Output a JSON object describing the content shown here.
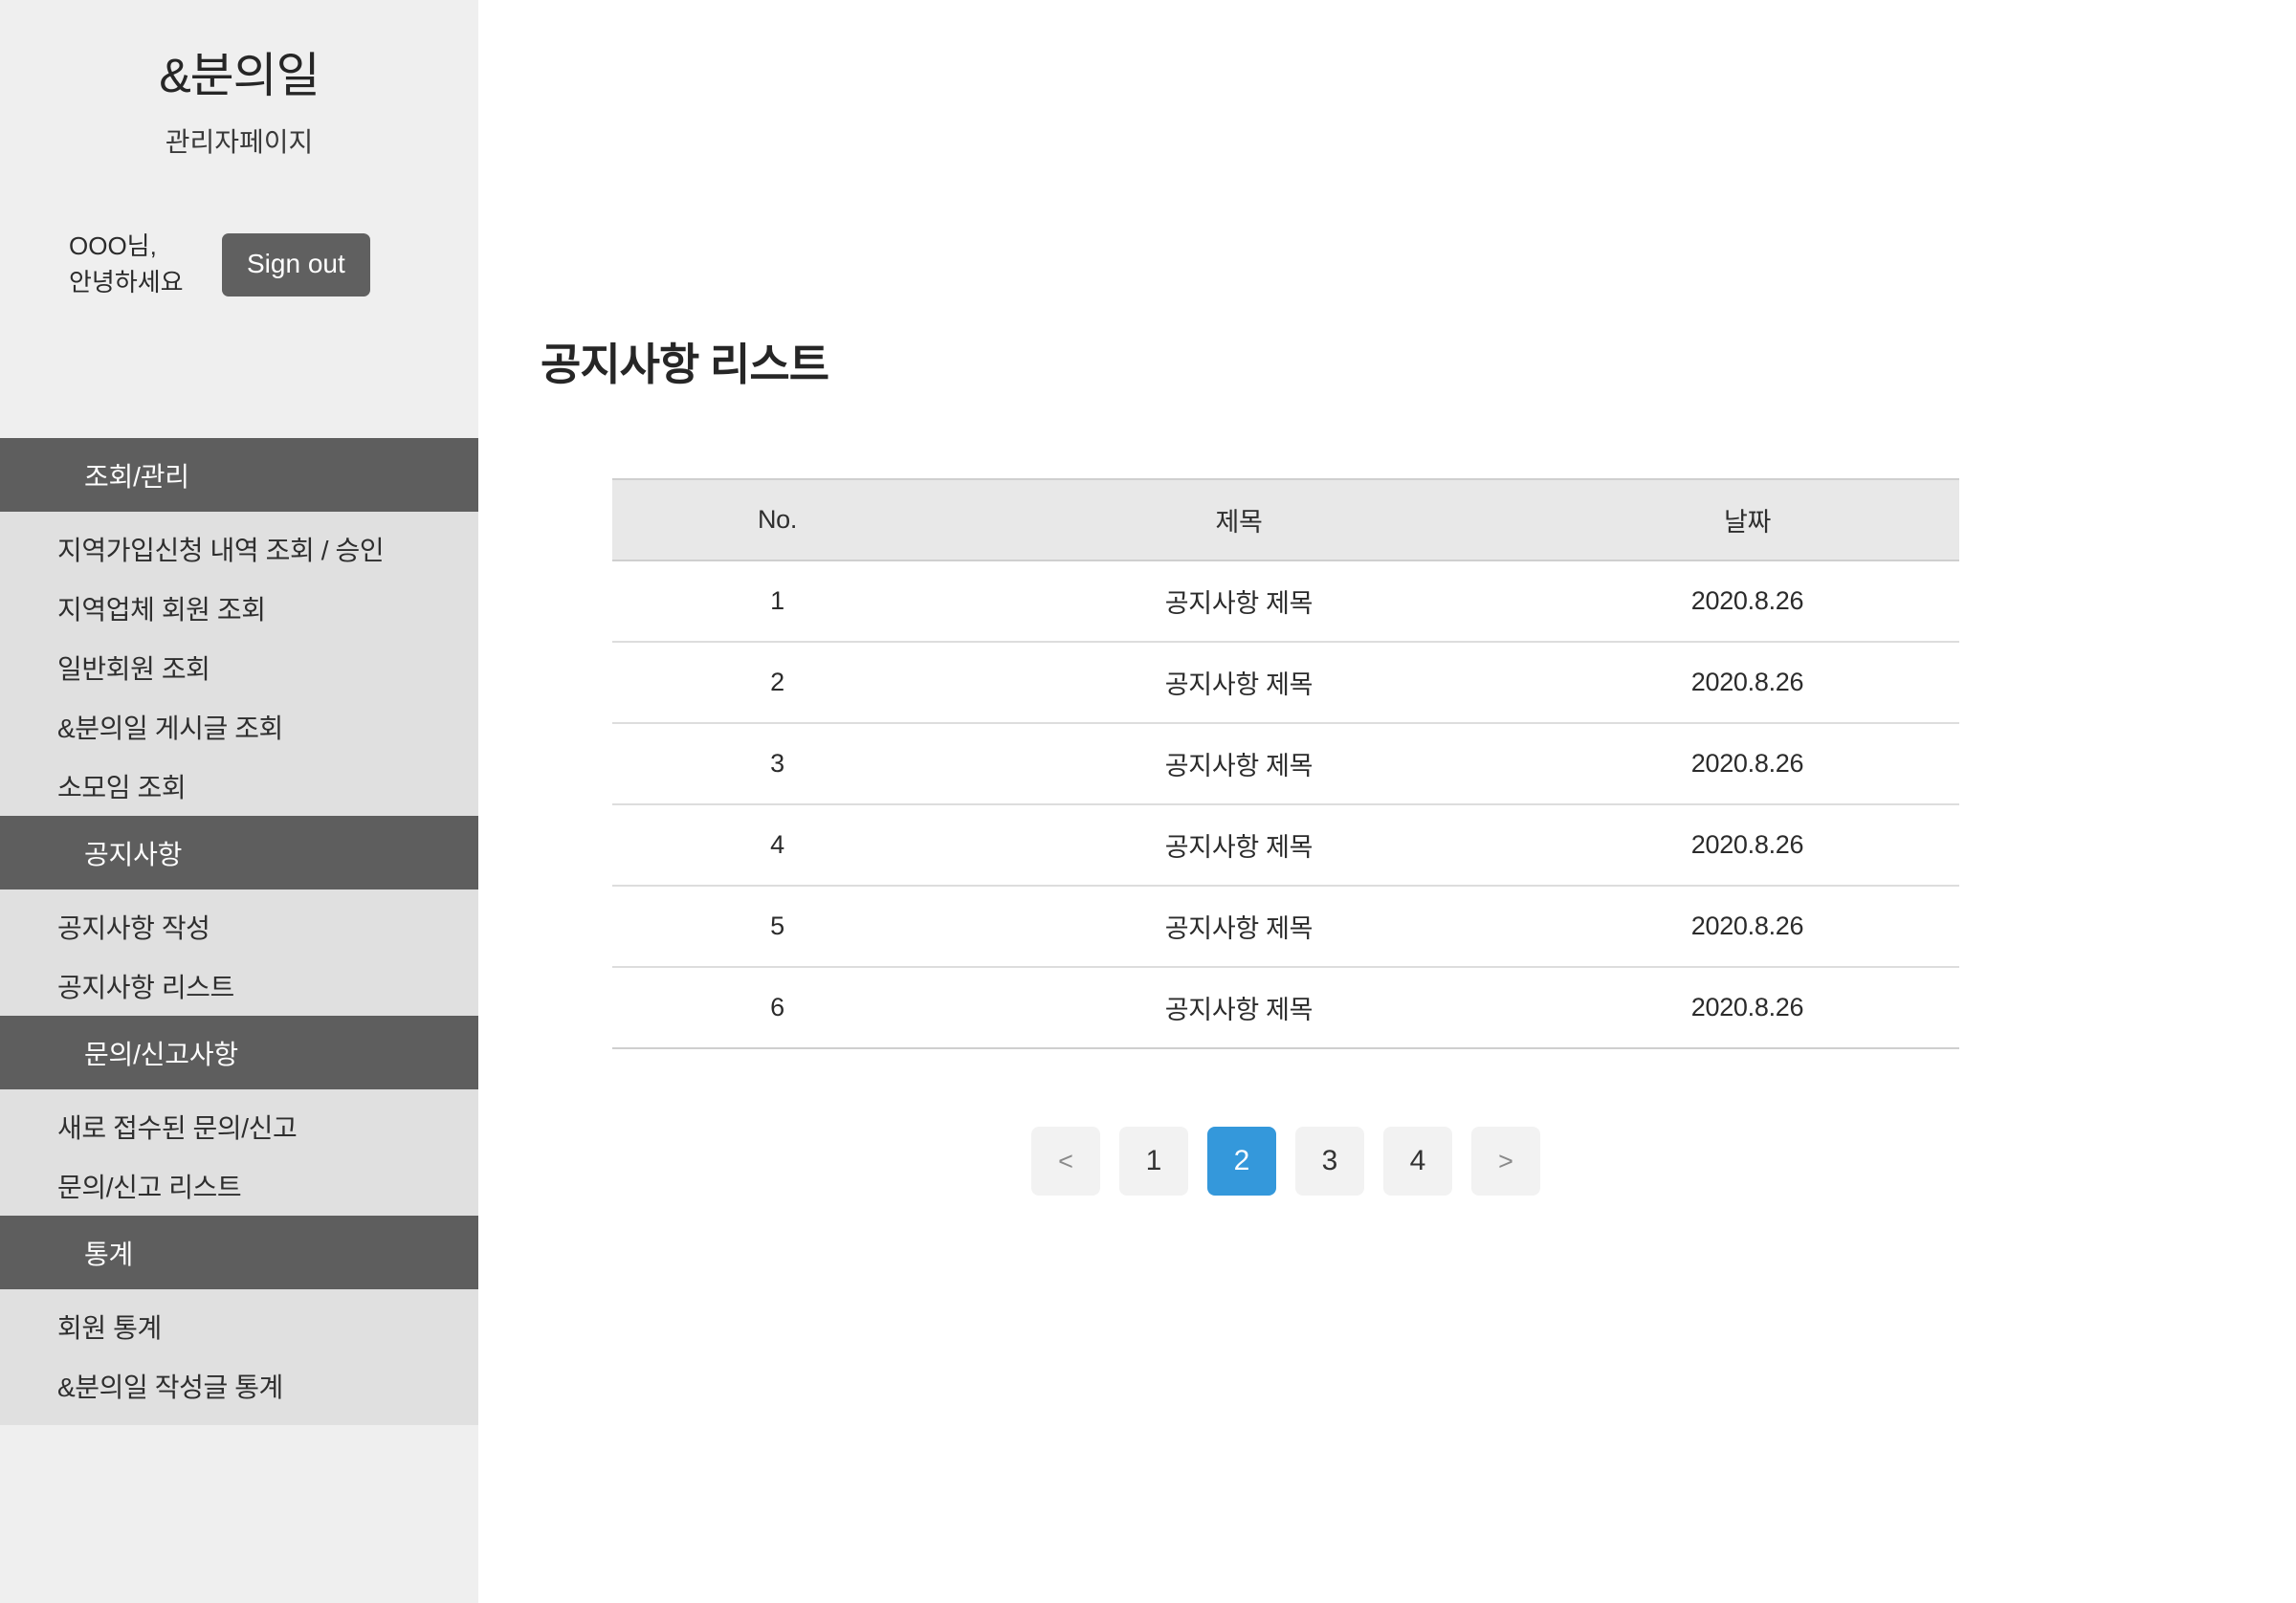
{
  "sidebar": {
    "brand_title": "&분의일",
    "brand_subtitle": "관리자페이지",
    "greeting": "OOO님,\n안녕하세요",
    "signout_label": "Sign out",
    "sections": [
      {
        "header": "조회/관리",
        "items": [
          "지역가입신청 내역 조회 / 승인",
          "지역업체 회원 조회",
          "일반회원 조회",
          "&분의일 게시글 조회",
          "소모임 조회"
        ]
      },
      {
        "header": "공지사항",
        "items": [
          "공지사항 작성",
          "공지사항 리스트"
        ]
      },
      {
        "header": "문의/신고사항",
        "items": [
          "새로 접수된 문의/신고",
          "문의/신고 리스트"
        ]
      },
      {
        "header": "통계",
        "items": [
          "회원 통계",
          "&분의일 작성글 통계"
        ]
      }
    ]
  },
  "main": {
    "page_title": "공지사항 리스트",
    "table": {
      "columns": [
        "No.",
        "제목",
        "날짜"
      ],
      "rows": [
        {
          "no": "1",
          "title": "공지사항 제목",
          "date": "2020.8.26"
        },
        {
          "no": "2",
          "title": "공지사항 제목",
          "date": "2020.8.26"
        },
        {
          "no": "3",
          "title": "공지사항 제목",
          "date": "2020.8.26"
        },
        {
          "no": "4",
          "title": "공지사항 제목",
          "date": "2020.8.26"
        },
        {
          "no": "5",
          "title": "공지사항 제목",
          "date": "2020.8.26"
        },
        {
          "no": "6",
          "title": "공지사항 제목",
          "date": "2020.8.26"
        }
      ]
    },
    "pagination": {
      "prev_label": "<",
      "next_label": ">",
      "pages": [
        "1",
        "2",
        "3",
        "4"
      ],
      "active_page": "2"
    }
  },
  "colors": {
    "accent": "#3498db",
    "section_header_bg": "#5e5e5e",
    "sidebar_bg": "#efefef",
    "menu_bg": "#e0e0e0",
    "signout_bg": "#606060",
    "table_header_bg": "#e8e8e8"
  }
}
